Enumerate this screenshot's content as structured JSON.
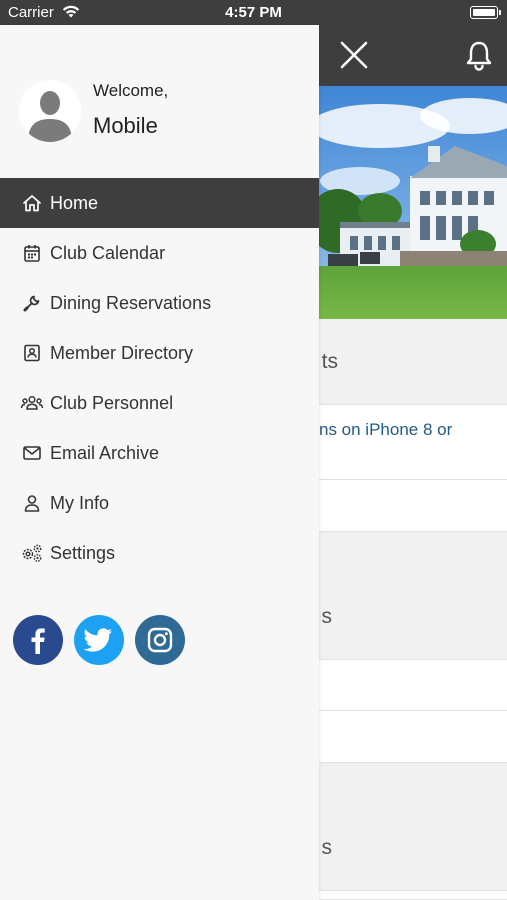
{
  "status_bar": {
    "carrier": "Carrier",
    "time": "4:57 PM"
  },
  "colors": {
    "header_bg": "#3e3e3e",
    "active_bg": "#3e3e3e",
    "link": "#235a86",
    "facebook": "#2a4a8f",
    "twitter": "#1da1f2",
    "instagram": "#2f6a95"
  },
  "drawer": {
    "welcome": "Welcome,",
    "user_name": "Mobile",
    "menu": [
      {
        "label": "Home",
        "icon": "home-icon",
        "active": true
      },
      {
        "label": "Club Calendar",
        "icon": "calendar-icon"
      },
      {
        "label": "Dining Reservations",
        "icon": "wrench-icon"
      },
      {
        "label": "Member Directory",
        "icon": "contact-book-icon"
      },
      {
        "label": "Club Personnel",
        "icon": "group-icon"
      },
      {
        "label": "Email Archive",
        "icon": "envelope-icon"
      },
      {
        "label": "My Info",
        "icon": "user-icon"
      },
      {
        "label": "Settings",
        "icon": "gears-icon"
      }
    ],
    "social": [
      "facebook-icon",
      "twitter-icon",
      "instagram-icon"
    ]
  },
  "background": {
    "section1_title_fragment": "ts",
    "link_fragment": "ns on iPhone 8 or",
    "section2_title_fragment": "s",
    "section3_title_fragment": "s"
  }
}
